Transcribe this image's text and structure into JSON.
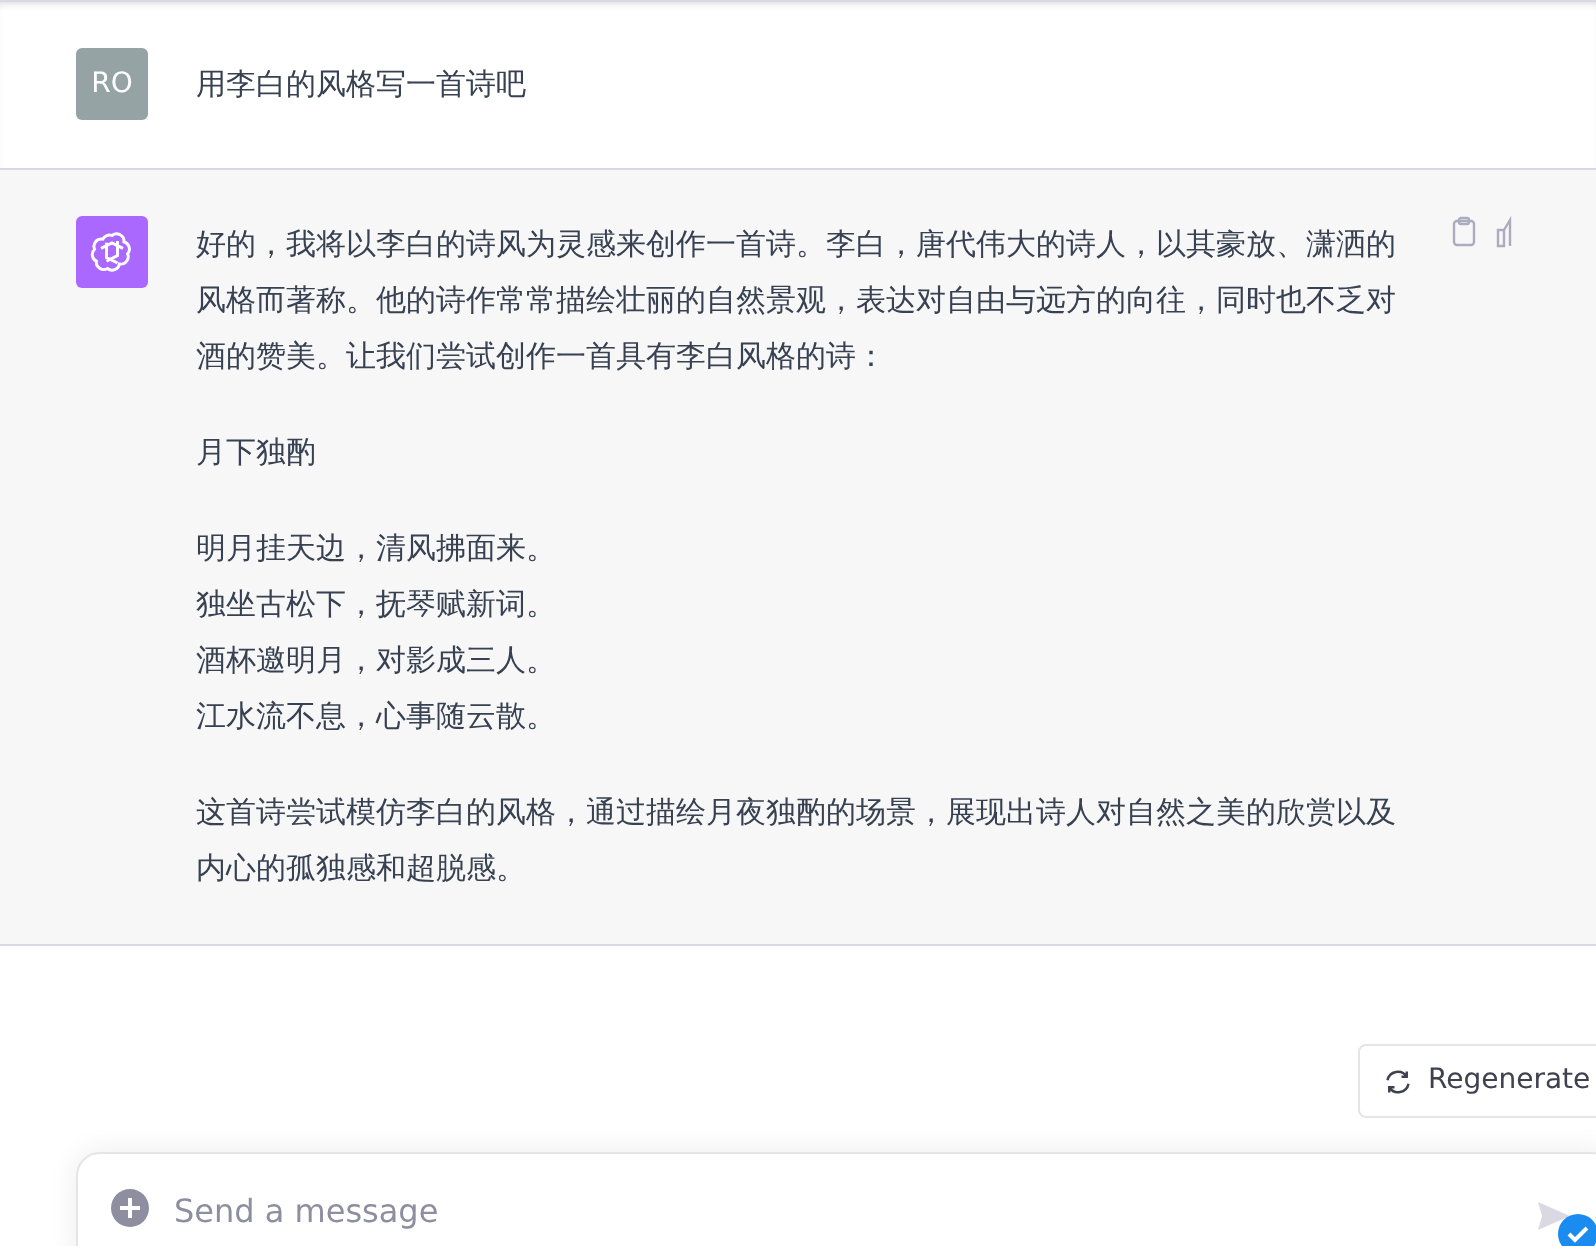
{
  "user_message": {
    "avatar": "RO",
    "text": "用李白的风格写一首诗吧"
  },
  "assistant_message": {
    "paragraphs": [
      "好的，我将以李白的诗风为灵感来创作一首诗。李白，唐代伟大的诗人，以其豪放、潇洒的风格而著称。他的诗作常常描绘壮丽的自然景观，表达对自由与远方的向往，同时也不乏对酒的赞美。让我们尝试创作一首具有李白风格的诗：",
      "月下独酌"
    ],
    "poem_lines": [
      "明月挂天边，清风拂面来。",
      "独坐古松下，抚琴赋新词。",
      "酒杯邀明月，对影成三人。",
      "江水流不息，心事随云散。"
    ],
    "closing": "这首诗尝试模仿李白的风格，通过描绘月夜独酌的场景，展现出诗人对自然之美的欣赏以及内心的孤独感和超脱感。"
  },
  "regenerate_button": "Regenerate",
  "composer": {
    "placeholder": "Send a message"
  }
}
